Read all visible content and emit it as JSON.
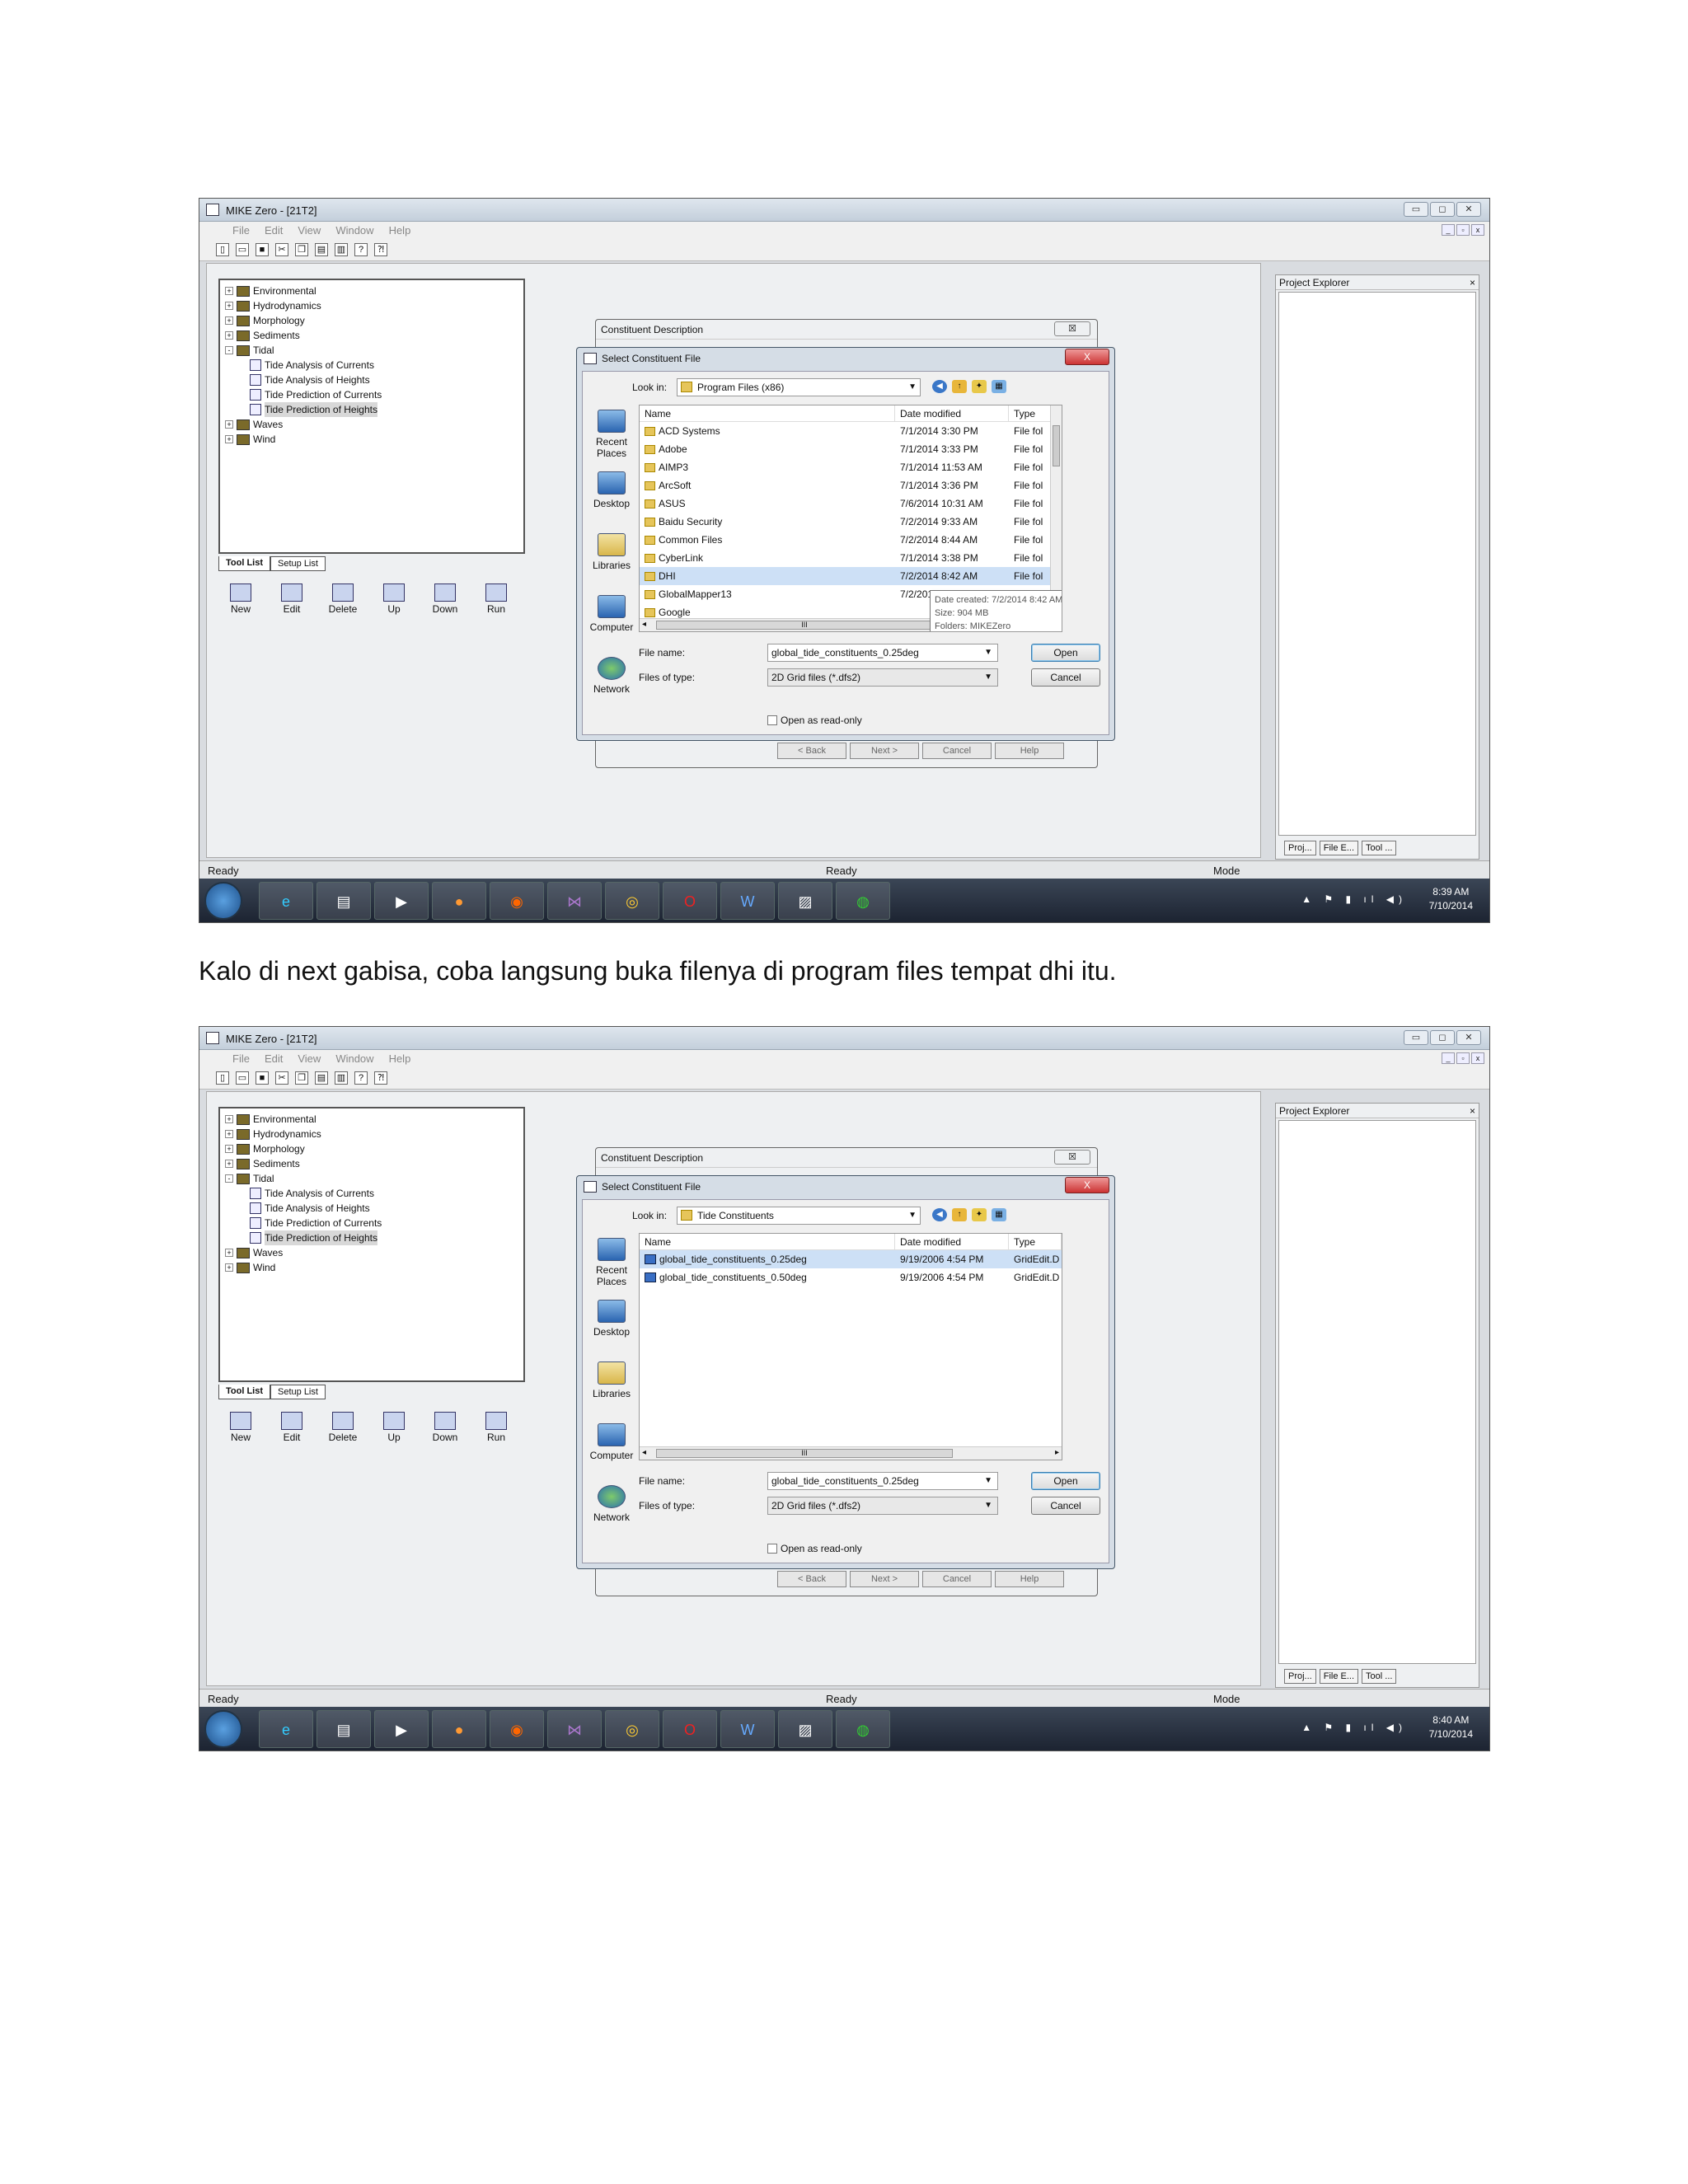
{
  "caption": "Kalo di next gabisa, coba langsung buka filenya di program files tempat dhi itu.",
  "app": {
    "title": "MIKE Zero - [21T2]",
    "menu": [
      "File",
      "Edit",
      "View",
      "Window",
      "Help"
    ],
    "tree": [
      {
        "label": "Environmental",
        "level": 0,
        "expander": "+"
      },
      {
        "label": "Hydrodynamics",
        "level": 0,
        "expander": "+"
      },
      {
        "label": "Morphology",
        "level": 0,
        "expander": "+"
      },
      {
        "label": "Sediments",
        "level": 0,
        "expander": "+"
      },
      {
        "label": "Tidal",
        "level": 0,
        "expander": "-"
      },
      {
        "label": "Tide Analysis of Currents",
        "level": 1
      },
      {
        "label": "Tide Analysis of Heights",
        "level": 1
      },
      {
        "label": "Tide Prediction of Currents",
        "level": 1
      },
      {
        "label": "Tide Prediction of Heights",
        "level": 1,
        "selected": true
      },
      {
        "label": "Waves",
        "level": 0,
        "expander": "+"
      },
      {
        "label": "Wind",
        "level": 0,
        "expander": "+"
      }
    ],
    "tabs": [
      "Tool List",
      "Setup List"
    ],
    "tools": [
      "New",
      "Edit",
      "Delete",
      "Up",
      "Down",
      "Run"
    ],
    "project_explorer": {
      "title": "Project Explorer",
      "close": "×",
      "tabs": [
        "Proj...",
        "File E...",
        "Tool ..."
      ]
    },
    "status": {
      "left": "Ready",
      "middle": "Ready",
      "right": "Mode"
    },
    "clock": {
      "time_1": "8:39 AM",
      "time_2": "8:40 AM",
      "date": "7/10/2014"
    }
  },
  "wizard": {
    "title": "Constituent Description",
    "close": "☒",
    "buttons": [
      "< Back",
      "Next >",
      "Cancel",
      "Help"
    ]
  },
  "dialog": {
    "title": "Select Constituent File",
    "close": "X",
    "look_in_label": "Look in:",
    "places": [
      "Recent Places",
      "Desktop",
      "Libraries",
      "Computer",
      "Network"
    ],
    "columns": [
      "Name",
      "Date modified",
      "Type"
    ],
    "file_name_label": "File name:",
    "file_name": "global_tide_constituents_0.25deg",
    "files_of_type_label": "Files of type:",
    "files_of_type": "2D Grid files (*.dfs2)",
    "open": "Open",
    "cancel": "Cancel",
    "read_only": "Open as read-only",
    "hscroll_glyph": "III"
  },
  "screenshot_1": {
    "look_in": "Program Files (x86)",
    "files": [
      {
        "name": "ACD Systems",
        "date": "7/1/2014 3:30 PM",
        "type": "File fol"
      },
      {
        "name": "Adobe",
        "date": "7/1/2014 3:33 PM",
        "type": "File fol"
      },
      {
        "name": "AIMP3",
        "date": "7/1/2014 11:53 AM",
        "type": "File fol"
      },
      {
        "name": "ArcSoft",
        "date": "7/1/2014 3:36 PM",
        "type": "File fol"
      },
      {
        "name": "ASUS",
        "date": "7/6/2014 10:31 AM",
        "type": "File fol"
      },
      {
        "name": "Baidu Security",
        "date": "7/2/2014 9:33 AM",
        "type": "File fol"
      },
      {
        "name": "Common Files",
        "date": "7/2/2014 8:44 AM",
        "type": "File fol"
      },
      {
        "name": "CyberLink",
        "date": "7/1/2014 3:38 PM",
        "type": "File fol"
      },
      {
        "name": "DHI",
        "date": "7/2/2014 8:42 AM",
        "type": "File fol",
        "selected": true
      },
      {
        "name": "GlobalMapper13",
        "date": "7/2/2014 8:54 AM",
        "type": "File fol"
      },
      {
        "name": "Google",
        "date": "",
        "type": "File fol"
      }
    ],
    "tooltip": [
      "Date created: 7/2/2014 8:42 AM",
      "Size: 904 MB",
      "Folders: MIKEZero"
    ]
  },
  "screenshot_2": {
    "look_in": "Tide Constituents",
    "files": [
      {
        "name": "global_tide_constituents_0.25deg",
        "date": "9/19/2006 4:54 PM",
        "type": "GridEdit.D",
        "selected": true
      },
      {
        "name": "global_tide_constituents_0.50deg",
        "date": "9/19/2006 4:54 PM",
        "type": "GridEdit.D"
      }
    ]
  }
}
